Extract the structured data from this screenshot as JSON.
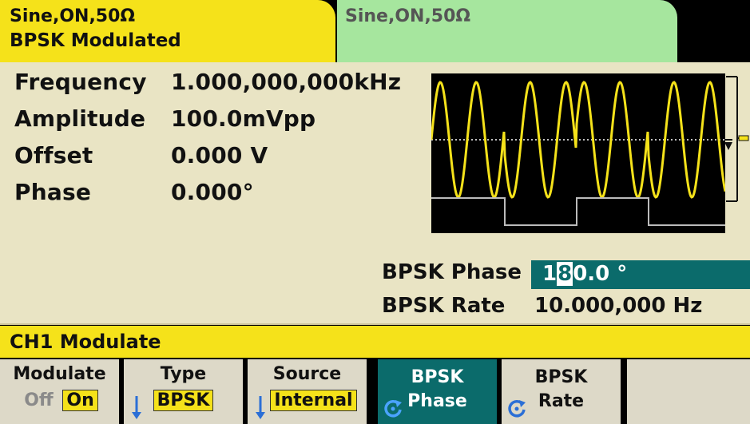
{
  "tabs": [
    {
      "line1": "Sine,ON,50Ω",
      "line2": "BPSK Modulated"
    },
    {
      "line1": "Sine,ON,50Ω"
    }
  ],
  "params": [
    {
      "name": "Frequency",
      "value": "1.000,000,000kHz"
    },
    {
      "name": "Amplitude",
      "value": "100.0mVpp"
    },
    {
      "name": "Offset",
      "value": "0.000 V"
    },
    {
      "name": "Phase",
      "value": "0.000°"
    }
  ],
  "bpsk": {
    "phase_label": "BPSK Phase",
    "phase_value_pre": "1",
    "phase_value_cursor": "8",
    "phase_value_post": "0.0 °",
    "rate_label": "BPSK Rate",
    "rate_value": "10.000,000 Hz"
  },
  "title": "CH1 Modulate",
  "softkeys": {
    "modulate": {
      "label": "Modulate",
      "off": "Off",
      "on": "On"
    },
    "type": {
      "label": "Type",
      "value": "BPSK"
    },
    "source": {
      "label": "Source",
      "value": "Internal"
    },
    "bpsk_phase": {
      "line1": "BPSK",
      "line2": "Phase"
    },
    "bpsk_rate": {
      "line1": "BPSK",
      "line2": "Rate"
    }
  },
  "colors": {
    "tab_active": "#f5e21a",
    "tab_inactive": "#a6e69e",
    "panel": "#e9e4c4",
    "accent": "#0b6b6b",
    "wave": "#f5e21a"
  },
  "icons": {
    "waveform": "sine-wave-preview",
    "bracket": "amplitude-bracket",
    "arrow": "down-arrow-icon",
    "rotate": "rotate-knob-icon"
  }
}
